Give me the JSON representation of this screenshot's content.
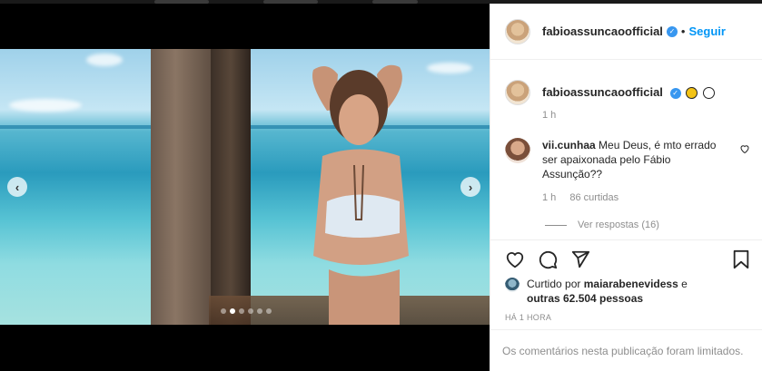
{
  "post": {
    "username": "fabioassuncaoofficial",
    "follow_separator": "•",
    "follow_label": "Seguir",
    "caption_time": "1 h",
    "carousel": {
      "slides": 6,
      "active_index": 1,
      "prev_icon": "chevron-left-icon",
      "next_icon": "chevron-right-icon"
    }
  },
  "comment": {
    "username": "vii.cunhaa",
    "text": "Meu Deus, é mto errado ser apaixonada pelo Fábio Assunção??",
    "time": "1 h",
    "likes": "86 curtidas",
    "view_replies": "Ver respostas (16)"
  },
  "likes_line": {
    "prefix": "Curtido por",
    "user": "maiarabenevidess",
    "connector": "e",
    "others": "outras 62.504 pessoas"
  },
  "date": "HÁ 1 HORA",
  "comments_limited": "Os comentários nesta publicação foram limitados.",
  "icons": [
    "heart-icon",
    "comment-icon",
    "share-icon",
    "bookmark-icon",
    "verified-icon"
  ],
  "colors": {
    "link": "#0095f6",
    "verified": "#3897f0",
    "muted": "#8e8e8e"
  }
}
